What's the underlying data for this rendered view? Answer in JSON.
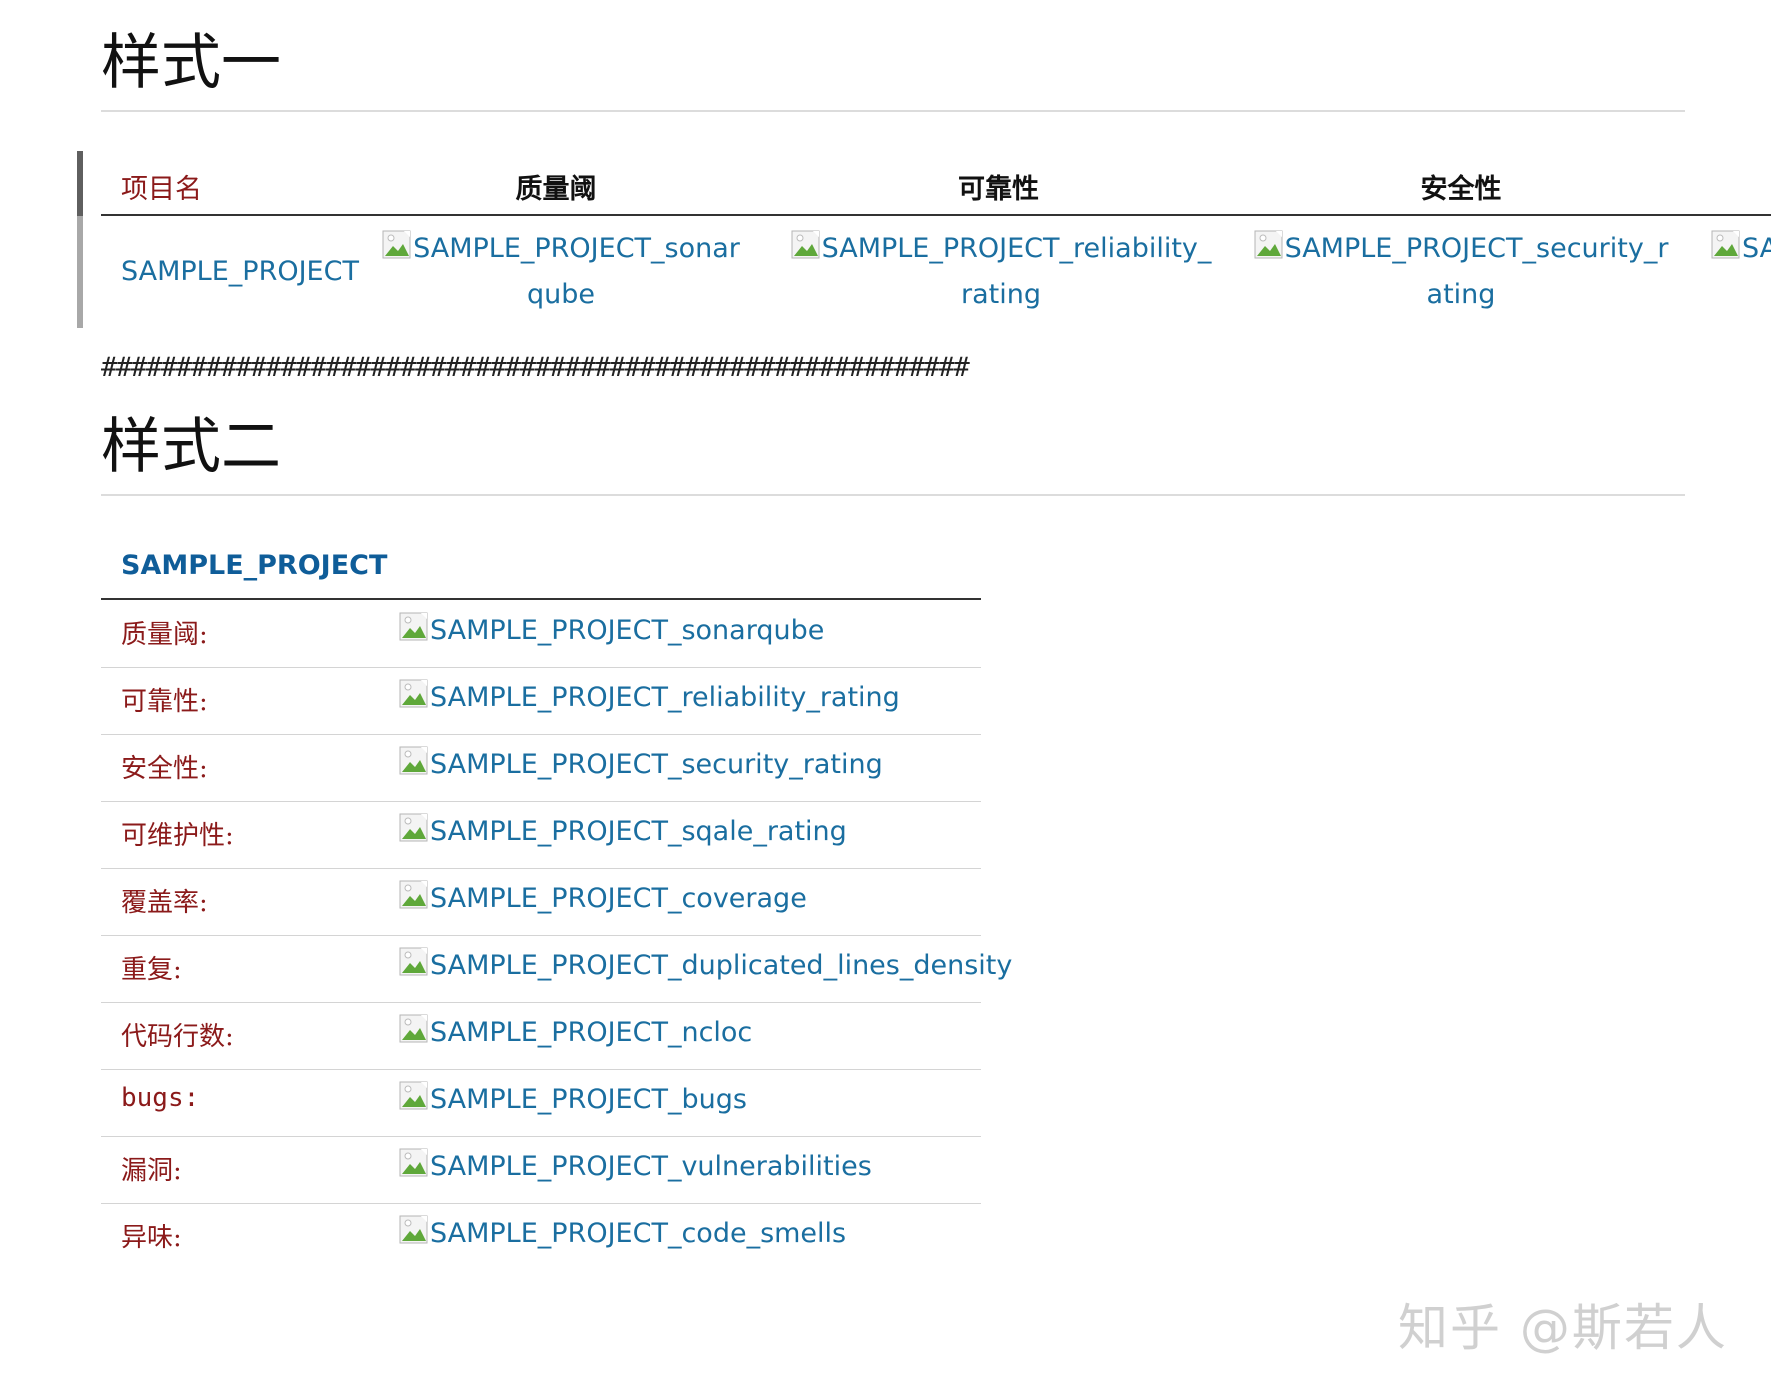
{
  "style_one": {
    "title": "样式一",
    "headers": {
      "name": "项目名",
      "quality_gate": "质量阈",
      "reliability": "可靠性",
      "security": "安全性"
    },
    "row": {
      "project": "SAMPLE_PROJECT",
      "quality_gate_alt": "SAMPLE_PROJECT_sonarqube",
      "reliability_alt": "SAMPLE_PROJECT_reliability_rating",
      "security_alt": "SAMPLE_PROJECT_security_rating",
      "next_alt": "SA"
    }
  },
  "separator": "##########################################################",
  "style_two": {
    "title": "样式二",
    "project": "SAMPLE_PROJECT",
    "rows": [
      {
        "label": "质量阈:",
        "value": "SAMPLE_PROJECT_sonarqube"
      },
      {
        "label": "可靠性:",
        "value": "SAMPLE_PROJECT_reliability_rating"
      },
      {
        "label": "安全性:",
        "value": "SAMPLE_PROJECT_security_rating"
      },
      {
        "label": "可维护性:",
        "value": "SAMPLE_PROJECT_sqale_rating"
      },
      {
        "label": "覆盖率:",
        "value": "SAMPLE_PROJECT_coverage"
      },
      {
        "label": "重复:",
        "value": "SAMPLE_PROJECT_duplicated_lines_density"
      },
      {
        "label": "代码行数:",
        "value": "SAMPLE_PROJECT_ncloc"
      },
      {
        "label": "bugs:",
        "value": "SAMPLE_PROJECT_bugs"
      },
      {
        "label": "漏洞:",
        "value": "SAMPLE_PROJECT_vulnerabilities"
      },
      {
        "label": "异味:",
        "value": "SAMPLE_PROJECT_code_smells"
      }
    ]
  },
  "watermark": "知乎 @斯若人",
  "icons": {
    "broken_image": "broken-image-icon"
  },
  "colors": {
    "link": "#1a6ea0",
    "label": "#8b1a1a",
    "caption": "#0f5d99"
  }
}
